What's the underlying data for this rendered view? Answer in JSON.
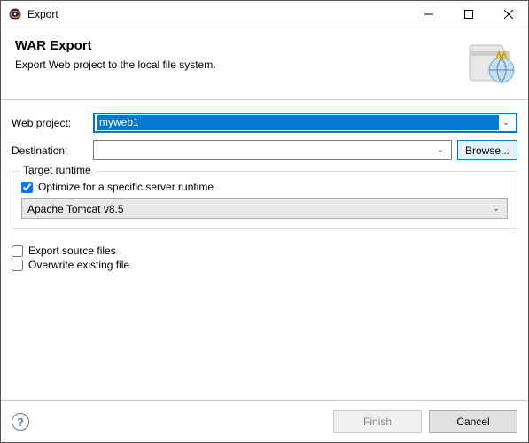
{
  "window": {
    "title": "Export"
  },
  "banner": {
    "title": "WAR Export",
    "subtitle": "Export Web project to the local file system."
  },
  "form": {
    "webproject_label": "Web project:",
    "webproject_value": "myweb1",
    "destination_label": "Destination:",
    "destination_value": "",
    "browse_label": "Browse..."
  },
  "target": {
    "group_title": "Target runtime",
    "optimize_label": "Optimize for a specific server runtime",
    "optimize_checked": true,
    "runtime_value": "Apache Tomcat v8.5"
  },
  "options": {
    "export_source_label": "Export source files",
    "export_source_checked": false,
    "overwrite_label": "Overwrite existing file",
    "overwrite_checked": false
  },
  "footer": {
    "finish_label": "Finish",
    "cancel_label": "Cancel"
  }
}
